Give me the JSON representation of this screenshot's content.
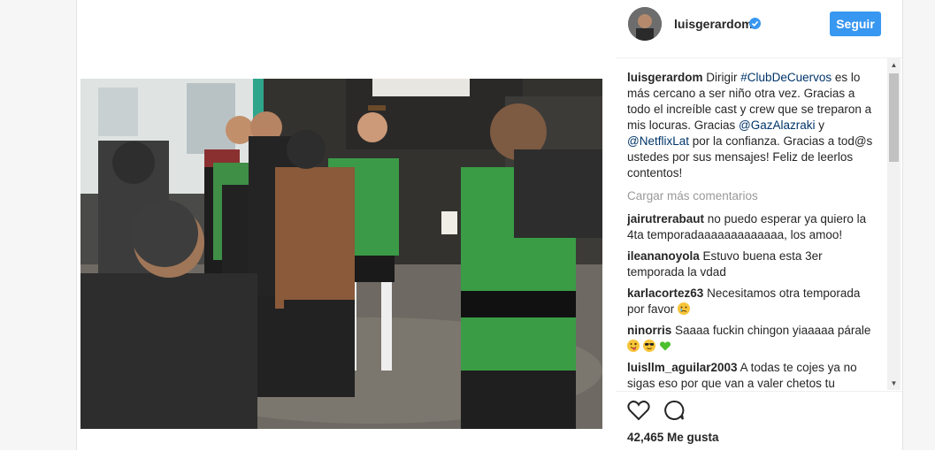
{
  "post": {
    "username": "luisgerardom",
    "follow_label": "Seguir",
    "caption_user": "luisgerardom",
    "caption_parts": [
      {
        "text": "Dirigir ",
        "link": false
      },
      {
        "text": "#ClubDeCuervos",
        "link": true
      },
      {
        "text": " es lo más cercano a ser niño otra vez. Gracias a todo el increíble cast y crew que se treparon a mis locuras. Gracias ",
        "link": false
      },
      {
        "text": "@GazAlazraki",
        "link": true
      },
      {
        "text": " y ",
        "link": false
      },
      {
        "text": "@NetflixLat",
        "link": true
      },
      {
        "text": " por la confianza. Gracias a tod@s ustedes por sus mensajes! Feliz de leerlos contentos!",
        "link": false
      }
    ],
    "load_more": "Cargar más comentarios",
    "comments": [
      {
        "user": "jairutrerabaut",
        "text": "no puedo esperar ya quiero la 4ta temporadaaaaaaaaaaaaa, los amoo!",
        "emojis": []
      },
      {
        "user": "ileananoyola",
        "text": "Estuvo buena esta 3er temporada la vdad",
        "emojis": []
      },
      {
        "user": "karlacortez63",
        "text": "Necesitamos otra temporada por favor",
        "emojis": [
          "crying-face"
        ]
      },
      {
        "user": "ninorris",
        "text": "Saaaa fuckin chingon yiaaaaa párale",
        "emojis": [
          "tongue-face",
          "sunglasses-face",
          "green-heart"
        ]
      },
      {
        "user": "luisllm_aguilar2003",
        "text": "A todas te cojes ya no sigas eso por que van a valer chetos tu",
        "emojis": []
      }
    ],
    "likes": "42,465 Me gusta",
    "colors": {
      "accent": "#3897f0",
      "link": "#003569",
      "muted": "#999999"
    }
  }
}
